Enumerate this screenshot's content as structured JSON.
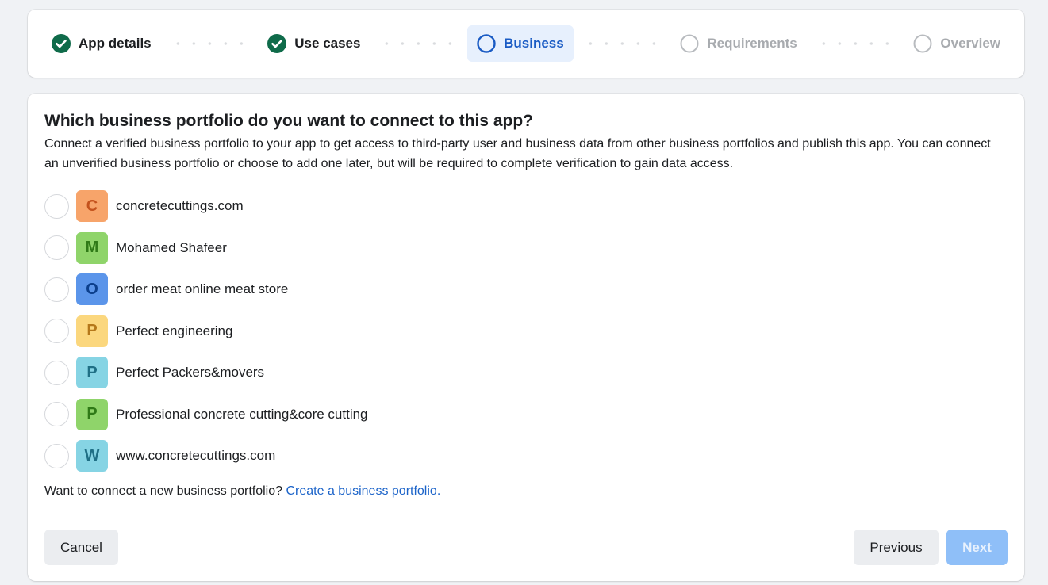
{
  "stepper": {
    "steps": [
      {
        "label": "App details",
        "state": "done",
        "icon": "check-circle-icon"
      },
      {
        "label": "Use cases",
        "state": "done",
        "icon": "check-circle-icon"
      },
      {
        "label": "Business",
        "state": "active",
        "icon": "circle-icon"
      },
      {
        "label": "Requirements",
        "state": "todo",
        "icon": "circle-icon"
      },
      {
        "label": "Overview",
        "state": "todo",
        "icon": "circle-icon"
      }
    ]
  },
  "main": {
    "title": "Which business portfolio do you want to connect to this app?",
    "description": "Connect a verified business portfolio to your app to get access to third-party user and business data from other business portfolios and publish this app. You can connect an unverified business portfolio or choose to add one later, but will be required to complete verification to gain data access.",
    "portfolios": [
      {
        "initial": "C",
        "name": "concretecuttings.com",
        "bg": "#f7a46a",
        "fg": "#c4521d"
      },
      {
        "initial": "M",
        "name": "Mohamed Shafeer",
        "bg": "#8fd46a",
        "fg": "#2f7a17"
      },
      {
        "initial": "O",
        "name": "order meat online meat store",
        "bg": "#5b95ea",
        "fg": "#0c3f8c"
      },
      {
        "initial": "P",
        "name": "Perfect engineering",
        "bg": "#fbd77e",
        "fg": "#b5781a"
      },
      {
        "initial": "P",
        "name": "Perfect Packers&movers",
        "bg": "#86d4e4",
        "fg": "#1f6f85"
      },
      {
        "initial": "P",
        "name": "Professional concrete cutting&core cutting",
        "bg": "#8fd46a",
        "fg": "#2f7a17"
      },
      {
        "initial": "W",
        "name": "www.concretecuttings.com",
        "bg": "#86d4e4",
        "fg": "#1f6f85"
      }
    ],
    "connect_prompt": "Want to connect a new business portfolio?",
    "create_link": "Create a business portfolio."
  },
  "footer": {
    "cancel_label": "Cancel",
    "previous_label": "Previous",
    "next_label": "Next"
  },
  "colors": {
    "accent": "#1a5bc4",
    "done_check": "#0f6b4a",
    "link": "#1b63c9",
    "next_disabled": "#8fbff8"
  }
}
